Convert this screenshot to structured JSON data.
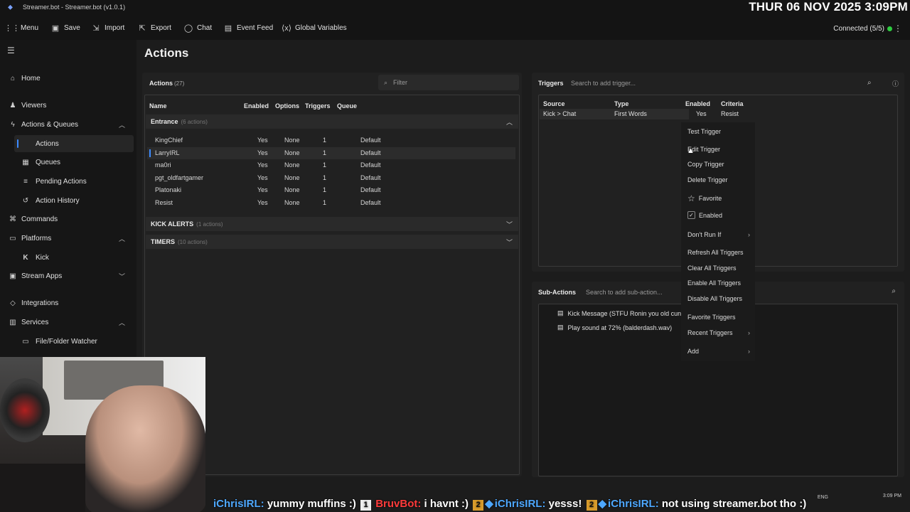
{
  "window": {
    "title": "Streamer.bot - Streamer.bot (v1.0.1)"
  },
  "overlay_clock": "THUR 06 NOV 2025 3:09PM",
  "toolbar": {
    "items": [
      {
        "label": "Menu",
        "icon": "grid-icon"
      },
      {
        "label": "Save",
        "icon": "save-icon"
      },
      {
        "label": "Import",
        "icon": "import-icon"
      },
      {
        "label": "Export",
        "icon": "export-icon"
      },
      {
        "label": "Chat",
        "icon": "chat-icon"
      },
      {
        "label": "Event Feed",
        "icon": "feed-icon"
      },
      {
        "label": "Global Variables",
        "icon": "variables-icon"
      }
    ],
    "status": "Connected (5/5)",
    "status_color": "#2ecc40"
  },
  "sidebar": {
    "items": [
      {
        "label": "Home"
      },
      {
        "label": "Viewers"
      },
      {
        "label": "Actions & Queues"
      },
      {
        "label": "Actions"
      },
      {
        "label": "Queues"
      },
      {
        "label": "Pending Actions"
      },
      {
        "label": "Action History"
      },
      {
        "label": "Commands"
      },
      {
        "label": "Platforms"
      },
      {
        "label": "Kick"
      },
      {
        "label": "Stream Apps"
      },
      {
        "label": "Integrations"
      },
      {
        "label": "Services"
      },
      {
        "label": "File/Folder Watcher"
      }
    ]
  },
  "page": {
    "title": "Actions"
  },
  "actions": {
    "heading": "Actions",
    "count": "(27)",
    "filter_placeholder": "Filter",
    "columns": [
      "Name",
      "Enabled",
      "Options",
      "Triggers",
      "Queue"
    ],
    "groups": [
      {
        "name": "Entrance",
        "count": "(6 actions)"
      },
      {
        "name": "KICK ALERTS",
        "count": "(1 actions)"
      },
      {
        "name": "TIMERS",
        "count": "(10 actions)"
      }
    ],
    "rows": [
      {
        "name": "KingChief",
        "enabled": "Yes",
        "options": "None",
        "triggers": "1",
        "queue": "Default"
      },
      {
        "name": "LarryIRL",
        "enabled": "Yes",
        "options": "None",
        "triggers": "1",
        "queue": "Default"
      },
      {
        "name": "ma0ri",
        "enabled": "Yes",
        "options": "None",
        "triggers": "1",
        "queue": "Default"
      },
      {
        "name": "pgt_oldfartgamer",
        "enabled": "Yes",
        "options": "None",
        "triggers": "1",
        "queue": "Default"
      },
      {
        "name": "Platonaki",
        "enabled": "Yes",
        "options": "None",
        "triggers": "1",
        "queue": "Default"
      },
      {
        "name": "Resist",
        "enabled": "Yes",
        "options": "None",
        "triggers": "1",
        "queue": "Default"
      }
    ]
  },
  "triggers": {
    "heading": "Triggers",
    "search_placeholder": "Search to add trigger...",
    "columns": [
      "Source",
      "Type",
      "Enabled",
      "Criteria"
    ],
    "row": {
      "source": "Kick > Chat",
      "type": "First Words",
      "enabled": "Yes",
      "criteria": "Resist"
    }
  },
  "context_menu": {
    "items": [
      {
        "label": "Test Trigger"
      },
      {
        "label": "Edit Trigger"
      },
      {
        "label": "Copy Trigger"
      },
      {
        "label": "Delete Trigger"
      },
      {
        "label": "Favorite",
        "icon": "star-icon"
      },
      {
        "label": "Enabled",
        "checked": true
      },
      {
        "label": "Don't Run If",
        "submenu": true
      },
      {
        "label": "Refresh All Triggers"
      },
      {
        "label": "Clear All Triggers"
      },
      {
        "label": "Enable All Triggers"
      },
      {
        "label": "Disable All Triggers"
      },
      {
        "label": "Favorite Triggers"
      },
      {
        "label": "Recent Triggers",
        "submenu": true
      },
      {
        "label": "Add",
        "submenu": true
      }
    ]
  },
  "subactions": {
    "heading": "Sub-Actions",
    "search_placeholder": "Search to add sub-action...",
    "items": [
      {
        "label": "Kick Message (STFU Ronin you old cunt)"
      },
      {
        "label": "Play sound at 72% (balderdash.wav)"
      }
    ]
  },
  "ticker": {
    "msg1_user": "iChrisIRL:",
    "msg1_text": "yummy muffins :)",
    "msg1_badge": "1",
    "msg2_user": "BruvBot:",
    "msg2_text": "i havnt :)",
    "msg2_badge": "2",
    "msg3_user": "iChrisIRL:",
    "msg3_text": "yesss!",
    "msg3_badge": "2",
    "msg4_user": "iChrisIRL:",
    "msg4_text": "not using streamer.bot tho :)"
  },
  "tray": {
    "lang": "ENG",
    "time": "3:09 PM"
  }
}
